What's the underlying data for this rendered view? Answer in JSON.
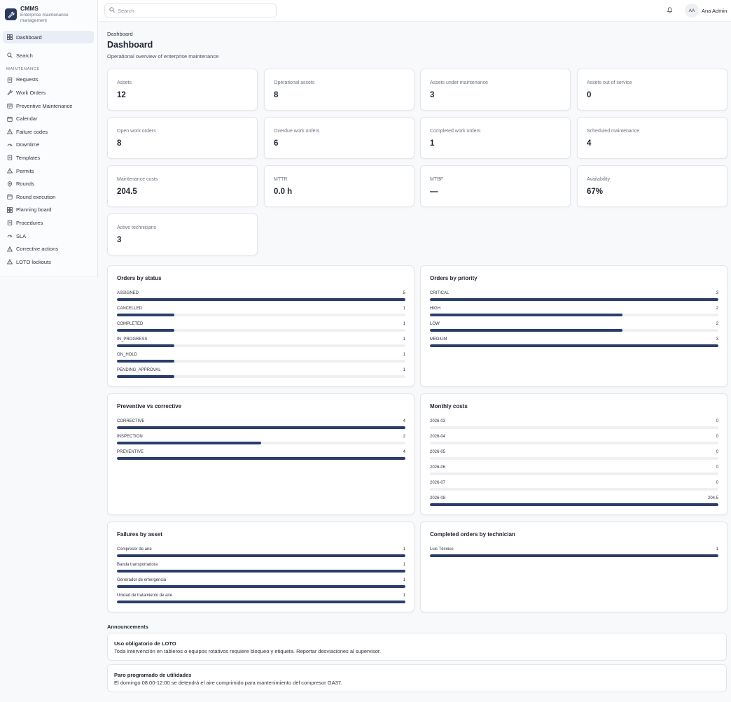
{
  "brand": {
    "name": "CMMS",
    "subtitle": "Enterprise maintenance management",
    "logo_icon": "wrench-icon"
  },
  "sidebar": {
    "active_item": {
      "label": "Dashboard",
      "icon": "dashboard-icon"
    },
    "search_item": {
      "label": "Search",
      "icon": "search-icon"
    },
    "section_label": "MAINTENANCE",
    "items": [
      {
        "label": "Requests",
        "icon": "clipboard-icon"
      },
      {
        "label": "Work Orders",
        "icon": "wrench-icon"
      },
      {
        "label": "Preventive Maintenance",
        "icon": "calendar-check-icon"
      },
      {
        "label": "Calendar",
        "icon": "calendar-icon"
      },
      {
        "label": "Failure codes",
        "icon": "warning-icon"
      },
      {
        "label": "Downtime",
        "icon": "gauge-icon"
      },
      {
        "label": "Templates",
        "icon": "clipboard-icon"
      },
      {
        "label": "Permits",
        "icon": "warning-icon"
      },
      {
        "label": "Rounds",
        "icon": "location-icon"
      },
      {
        "label": "Round execution",
        "icon": "calendar-icon"
      },
      {
        "label": "Planning board",
        "icon": "grid-icon"
      },
      {
        "label": "Procedures",
        "icon": "clipboard-icon"
      },
      {
        "label": "SLA",
        "icon": "gauge-icon"
      },
      {
        "label": "Corrective actions",
        "icon": "warning-icon"
      },
      {
        "label": "LOTO lockouts",
        "icon": "warning-icon"
      }
    ]
  },
  "topbar": {
    "search_placeholder": "Search",
    "user_initials": "AA",
    "user_name": "Ana Admin"
  },
  "page": {
    "breadcrumb": "Dashboard",
    "title": "Dashboard",
    "subtitle": "Operational overview of enterprise maintenance"
  },
  "kpis": [
    {
      "label": "Assets",
      "value": "12"
    },
    {
      "label": "Operational assets",
      "value": "8"
    },
    {
      "label": "Assets under maintenance",
      "value": "3"
    },
    {
      "label": "Assets out of service",
      "value": "0"
    },
    {
      "label": "Open work orders",
      "value": "8"
    },
    {
      "label": "Overdue work orders",
      "value": "6"
    },
    {
      "label": "Completed work orders",
      "value": "1"
    },
    {
      "label": "Scheduled maintenance",
      "value": "4"
    },
    {
      "label": "Maintenance costs",
      "value": "204.5"
    },
    {
      "label": "MTTR",
      "value": "0.0 h"
    },
    {
      "label": "MTBF",
      "value": "—"
    },
    {
      "label": "Availability",
      "value": "67%"
    },
    {
      "label": "Active technicians",
      "value": "3"
    }
  ],
  "panels": [
    {
      "title": "Orders by status",
      "max": 5,
      "rows": [
        {
          "label": "ASSIGNED",
          "value": 5
        },
        {
          "label": "CANCELLED",
          "value": 1
        },
        {
          "label": "COMPLETED",
          "value": 1
        },
        {
          "label": "IN_PROGRESS",
          "value": 1
        },
        {
          "label": "ON_HOLD",
          "value": 1
        },
        {
          "label": "PENDING_APPROVAL",
          "value": 1
        }
      ]
    },
    {
      "title": "Orders by priority",
      "max": 3,
      "rows": [
        {
          "label": "CRITICAL",
          "value": 3
        },
        {
          "label": "HIGH",
          "value": 2
        },
        {
          "label": "LOW",
          "value": 2
        },
        {
          "label": "MEDIUM",
          "value": 3
        }
      ]
    },
    {
      "title": "Preventive vs corrective",
      "max": 4,
      "rows": [
        {
          "label": "CORRECTIVE",
          "value": 4
        },
        {
          "label": "INSPECTION",
          "value": 2
        },
        {
          "label": "PREVENTIVE",
          "value": 4
        }
      ]
    },
    {
      "title": "Monthly costs",
      "max": 204.5,
      "rows": [
        {
          "label": "2026-03",
          "value": 0
        },
        {
          "label": "2026-04",
          "value": 0
        },
        {
          "label": "2026-05",
          "value": 0
        },
        {
          "label": "2026-06",
          "value": 0
        },
        {
          "label": "2026-07",
          "value": 0
        },
        {
          "label": "2026-08",
          "value": 204.5
        }
      ]
    },
    {
      "title": "Failures by asset",
      "max": 1,
      "rows": [
        {
          "label": "Compresor de aire",
          "value": 1
        },
        {
          "label": "Banda transportadora",
          "value": 1
        },
        {
          "label": "Generador de emergencia",
          "value": 1
        },
        {
          "label": "Unidad de tratamiento de aire",
          "value": 1
        }
      ]
    },
    {
      "title": "Completed orders by technician",
      "max": 1,
      "rows": [
        {
          "label": "Luis Técnico",
          "value": 1
        }
      ]
    }
  ],
  "announcements": {
    "heading": "Announcements",
    "items": [
      {
        "title": "Uso obligatorio de LOTO",
        "body": "Toda intervención en tableros o equipos rotativos requiere bloqueo y etiqueta. Reportar desviaciones al supervisor."
      },
      {
        "title": "Paro programado de utilidades",
        "body": "El domingo 08:00-12:00 se detendrá el aire comprimido para mantenimiento del compresor GA37."
      }
    ]
  },
  "colors": {
    "accent": "#2b3e6b",
    "track": "#eef0f4",
    "active_nav": "#e8edf6"
  }
}
